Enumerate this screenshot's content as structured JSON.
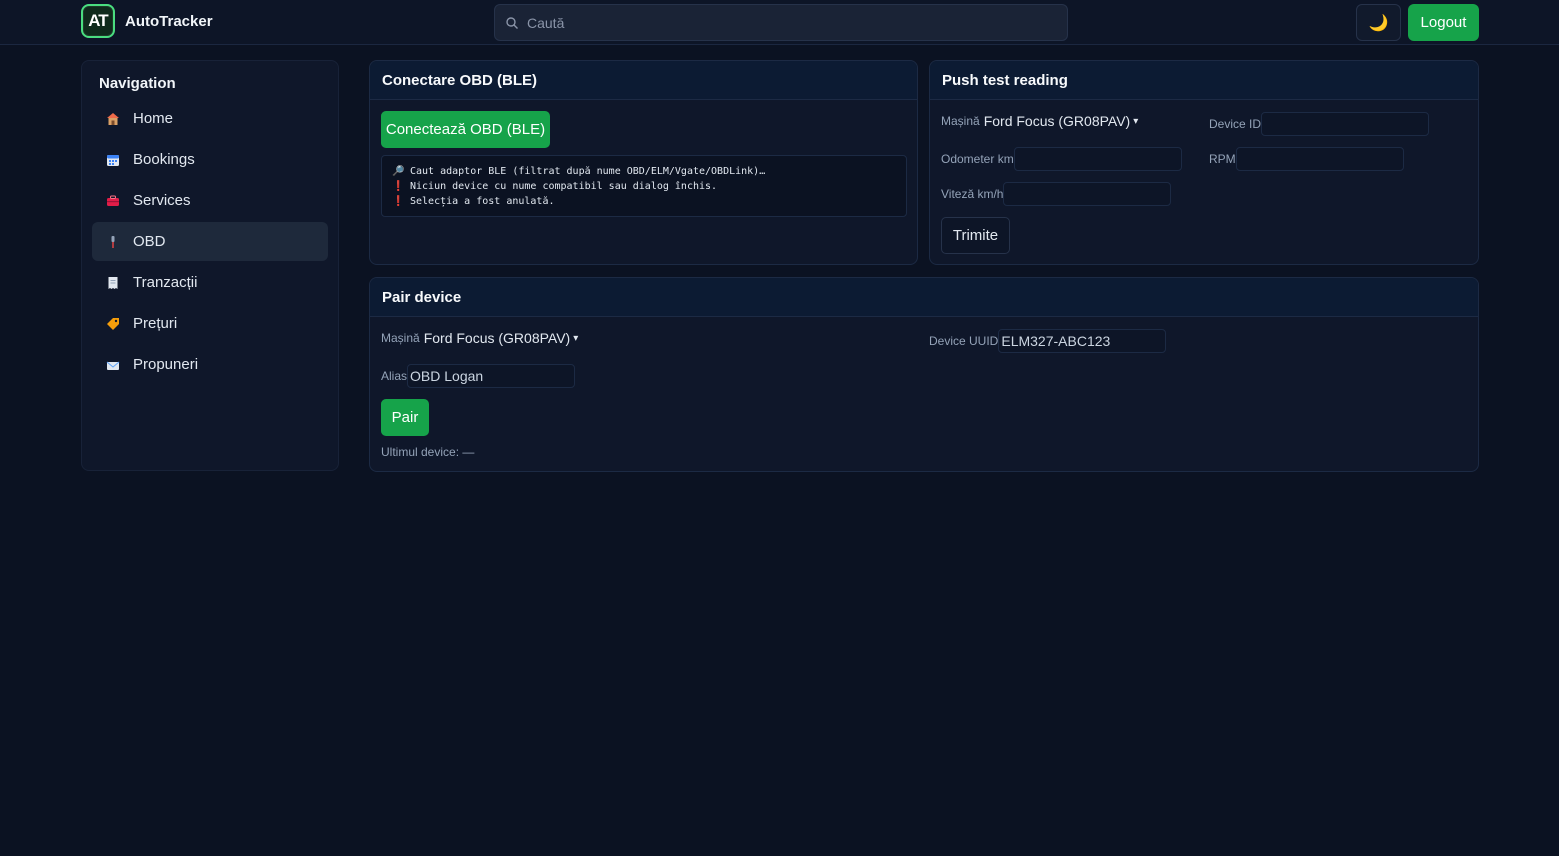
{
  "app": {
    "name": "AutoTracker",
    "logo_text": "AT"
  },
  "search": {
    "placeholder": "Caută"
  },
  "header": {
    "theme_icon": "🌙",
    "logout_label": "Logout"
  },
  "sidebar": {
    "title": "Navigation",
    "items": [
      {
        "label": "Home",
        "icon": "house-icon"
      },
      {
        "label": "Bookings",
        "icon": "calendar-icon"
      },
      {
        "label": "Services",
        "icon": "toolbox-icon"
      },
      {
        "label": "OBD",
        "icon": "plug-icon",
        "active": true
      },
      {
        "label": "Tranzacții",
        "icon": "receipt-icon"
      },
      {
        "label": "Prețuri",
        "icon": "tag-icon"
      },
      {
        "label": "Propuneri",
        "icon": "envelope-icon"
      }
    ]
  },
  "obd_connect": {
    "title": "Conectare OBD (BLE)",
    "connect_label": "Conectează OBD (BLE)",
    "log": [
      {
        "icon": "magnifier-icon",
        "glyph": "🔎",
        "text": "Caut adaptor BLE (filtrat după nume OBD/ELM/Vgate/OBDLink)…"
      },
      {
        "icon": "exclamation-icon",
        "glyph": "❗",
        "text": "Niciun device cu nume compatibil sau dialog închis."
      },
      {
        "icon": "exclamation-icon",
        "glyph": "❗",
        "text": "Selecția a fost anulată."
      }
    ]
  },
  "push_test": {
    "title": "Push test reading",
    "car_label": "Mașină",
    "car_value": "Ford Focus (GR08PAV)",
    "device_id_label": "Device ID",
    "device_id_value": "",
    "odometer_label": "Odometer km",
    "odometer_value": "",
    "rpm_label": "RPM",
    "rpm_value": "",
    "speed_label": "Viteză km/h",
    "speed_value": "",
    "submit_label": "Trimite"
  },
  "pair_device": {
    "title": "Pair device",
    "car_label": "Mașină",
    "car_value": "Ford Focus (GR08PAV)",
    "uuid_label": "Device UUID",
    "uuid_value": "ELM327-ABC123",
    "alias_label": "Alias",
    "alias_value": "OBD Logan",
    "pair_label": "Pair",
    "last_device": "Ultimul device: —"
  },
  "colors": {
    "background": "#0b1222",
    "card": "#0f172a",
    "accent_green": "#16a34a",
    "logo_border": "#4ade80"
  }
}
